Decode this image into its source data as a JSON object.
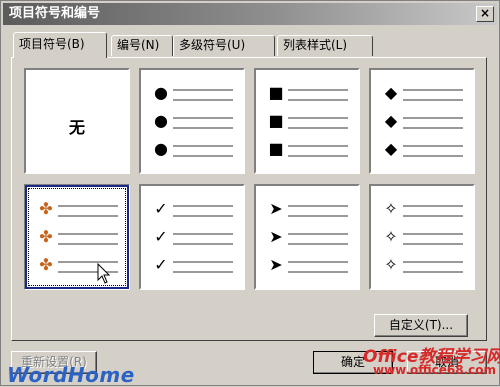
{
  "window": {
    "title": "项目符号和编号",
    "close_glyph": "×"
  },
  "tabs": [
    {
      "label": "项目符号(B)"
    },
    {
      "label": "编号(N)"
    },
    {
      "label": "多级符号(U)"
    },
    {
      "label": "列表样式(L)"
    }
  ],
  "bullets": {
    "none_label": "无",
    "styles": [
      {
        "glyph": "●",
        "icon": "dot-bullet-icon"
      },
      {
        "glyph": "■",
        "icon": "square-bullet-icon"
      },
      {
        "glyph": "◆",
        "icon": "diamond-bullet-icon"
      },
      {
        "glyph": "✤",
        "icon": "colored-flower-bullet-icon"
      },
      {
        "glyph": "✓",
        "icon": "checkmark-bullet-icon"
      },
      {
        "glyph": "➤",
        "icon": "arrowhead-bullet-icon"
      },
      {
        "glyph": "✧",
        "icon": "star-bullet-icon"
      }
    ],
    "selected_index": 4
  },
  "buttons": {
    "customize": "自定义(T)...",
    "reset": "重新设置(R)",
    "ok": "确定",
    "cancel": "取消"
  },
  "watermarks": {
    "left": "WordHome",
    "right": "Office教程学习网",
    "right_url": "www.office68.com"
  },
  "colors": {
    "selection": "#1b2a86",
    "title_dark": "#5b5b5b"
  }
}
